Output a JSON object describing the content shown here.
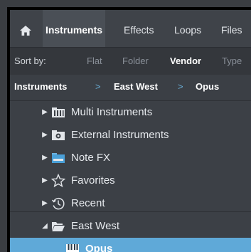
{
  "tabs": {
    "home_icon": "home-icon",
    "items": [
      {
        "label": "Instruments",
        "active": true
      },
      {
        "label": "Effects",
        "active": false
      },
      {
        "label": "Loops",
        "active": false
      },
      {
        "label": "Files",
        "active": false
      }
    ]
  },
  "sort": {
    "label": "Sort by:",
    "options": [
      {
        "label": "Flat",
        "selected": false
      },
      {
        "label": "Folder",
        "selected": false
      },
      {
        "label": "Vendor",
        "selected": true
      },
      {
        "label": "Type",
        "selected": false
      }
    ]
  },
  "breadcrumb": {
    "items": [
      "Instruments",
      "East West",
      "Opus"
    ],
    "separator": ">"
  },
  "tree": {
    "items": [
      {
        "label": "Multi Instruments",
        "icon": "multi-instruments-icon",
        "expanded": false
      },
      {
        "label": "External Instruments",
        "icon": "external-instruments-icon",
        "expanded": false
      },
      {
        "label": "Note FX",
        "icon": "note-fx-icon",
        "expanded": false
      },
      {
        "label": "Favorites",
        "icon": "star-icon",
        "expanded": false
      },
      {
        "label": "Recent",
        "icon": "clock-icon",
        "expanded": false
      },
      {
        "label": "East West",
        "icon": "folder-open-icon",
        "expanded": true
      },
      {
        "label": "Opus",
        "icon": "piano-keys-icon",
        "selected": true
      }
    ]
  },
  "colors": {
    "selection": "#5fa9d8",
    "breadcrumb_separator": "#6aaed6"
  }
}
